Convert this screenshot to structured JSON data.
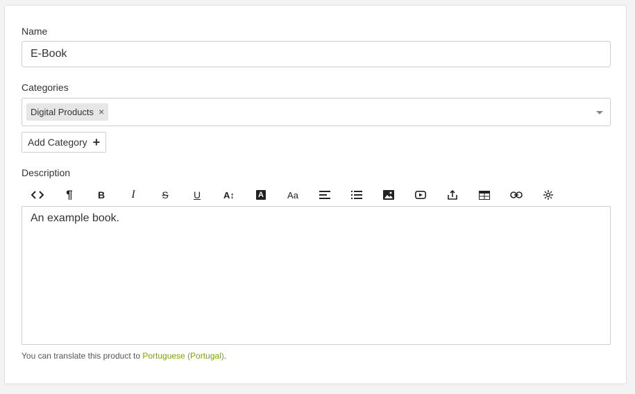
{
  "form": {
    "name_label": "Name",
    "name_value": "E-Book",
    "categories_label": "Categories",
    "categories": [
      {
        "label": "Digital Products",
        "remove": "×"
      }
    ],
    "add_category_label": "Add Category",
    "description_label": "Description",
    "description_value": "An example book.",
    "hint_prefix": "You can translate this product to ",
    "hint_link": "Portuguese (Portugal)",
    "hint_suffix": "."
  },
  "toolbar": {
    "buttons": [
      {
        "icon": "code-view-icon",
        "glyph": "<>"
      },
      {
        "icon": "paragraph-icon",
        "glyph": "¶"
      },
      {
        "icon": "bold-icon",
        "glyph": "B"
      },
      {
        "icon": "italic-icon",
        "glyph": "I"
      },
      {
        "icon": "strikethrough-icon",
        "glyph": "S"
      },
      {
        "icon": "underline-icon",
        "glyph": "U"
      },
      {
        "icon": "font-size-icon",
        "glyph": "A↕"
      },
      {
        "icon": "font-color-icon",
        "glyph": "A"
      },
      {
        "icon": "font-family-icon",
        "glyph": "Aa"
      },
      {
        "icon": "align-icon"
      },
      {
        "icon": "list-icon"
      },
      {
        "icon": "image-icon"
      },
      {
        "icon": "video-icon"
      },
      {
        "icon": "upload-icon"
      },
      {
        "icon": "table-icon"
      },
      {
        "icon": "link-icon"
      },
      {
        "icon": "special-chars-icon"
      }
    ]
  },
  "colors": {
    "link": "#7aa500",
    "border": "#cccccc",
    "tag_bg": "#e6e6e6"
  }
}
